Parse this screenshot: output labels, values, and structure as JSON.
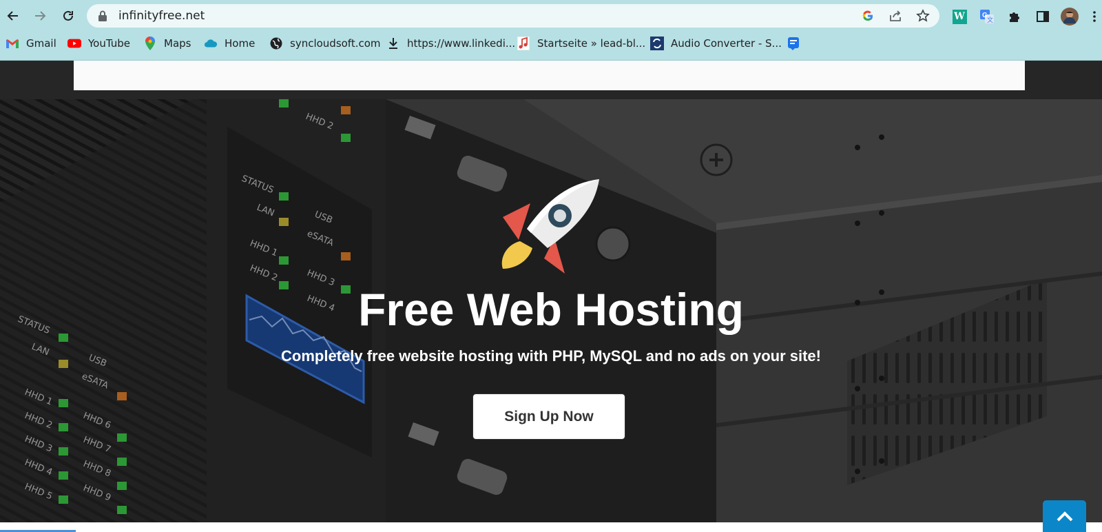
{
  "browser": {
    "url": "infinityfree.net",
    "bookmarks": [
      {
        "label": "Gmail",
        "icon": "gmail-icon"
      },
      {
        "label": "YouTube",
        "icon": "youtube-icon"
      },
      {
        "label": "Maps",
        "icon": "maps-icon"
      },
      {
        "label": "Home",
        "icon": "cloud-icon"
      },
      {
        "label": "syncloudsoft.com",
        "icon": "globe-icon"
      },
      {
        "label": "https://www.linkedi...",
        "icon": "download-icon"
      },
      {
        "label": "Startseite » lead-bl...",
        "icon": "music-note-icon"
      },
      {
        "label": "Audio Converter - S...",
        "icon": "converter-icon"
      }
    ],
    "extensions": [
      "W"
    ]
  },
  "hero": {
    "headline": "Free Web Hosting",
    "subline": "Completely free website hosting with PHP, MySQL and no ads on your site!",
    "cta_label": "Sign Up Now"
  },
  "panel_labels": {
    "status": "STATUS",
    "lan": "LAN",
    "usb": "USB",
    "esata": "eSATA",
    "hhd1": "HHD 1",
    "hhd2": "HHD 2",
    "hhd3": "HHD 3",
    "hhd4": "HHD 4",
    "hhd5": "HHD 5",
    "hhd6": "HHD 6",
    "hhd7": "HHD 7",
    "hhd8": "HHD 8",
    "hhd9": "HHD 9"
  },
  "colors": {
    "chrome_bg": "#b6e0e4",
    "site_dark": "#262626",
    "cta_bg": "#ffffff",
    "back_to_top": "#0b87c9",
    "rocket_red": "#e4574b",
    "rocket_yellow": "#f2c94c"
  }
}
